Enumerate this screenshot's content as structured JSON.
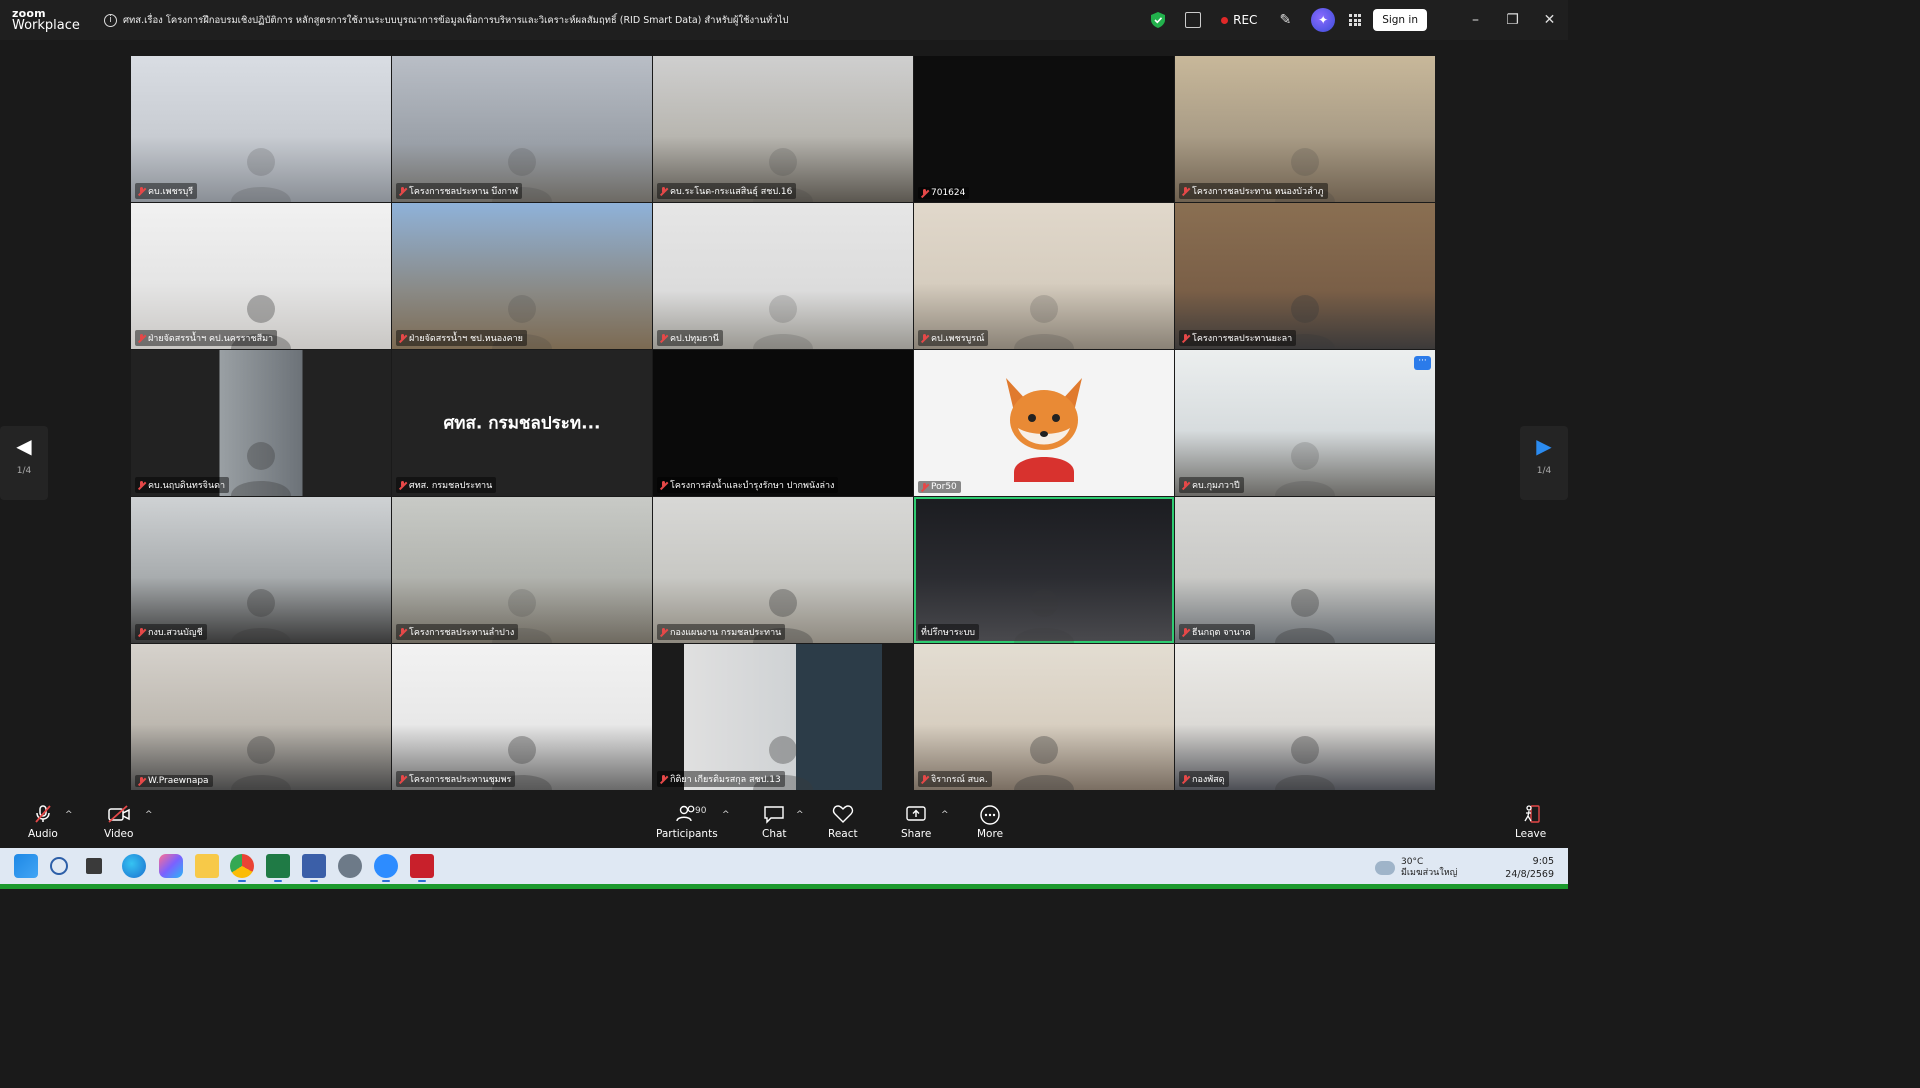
{
  "titlebar": {
    "logo_line1": "zoom",
    "logo_line2": "Workplace",
    "meeting_topic": "ศทส.เรื่อง โครงการฝึกอบรมเชิงปฏิบัติการ หลักสูตรการใช้งานระบบบูรณาการข้อมูลเพื่อการบริหารและวิเคราะห์ผลสัมฤทธิ์ (RID Smart Data) สำหรับผู้ใช้งานทั่วไป",
    "rec_label": "REC",
    "sign_in_label": "Sign in",
    "icons": [
      "info-icon",
      "shield-icon",
      "notes-icon",
      "brush-icon",
      "ai-companion-icon",
      "apps-grid-icon",
      "minimize-icon",
      "restore-icon",
      "close-icon"
    ],
    "colors": {
      "shield": "#22b14c",
      "rec_dot": "#e02828"
    }
  },
  "grid": {
    "tiles": [
      {
        "name": "คบ.เพชรบุรี",
        "muted": true,
        "video": true
      },
      {
        "name": "โครงการชลประทาน บึงกาฬ",
        "muted": true,
        "video": true
      },
      {
        "name": "คบ.ระโนด-กระแสสินธุ์ สชป.16",
        "muted": true,
        "video": true
      },
      {
        "name": "701624",
        "muted": true,
        "video": false
      },
      {
        "name": "โครงการชลประทาน หนองบัวลำภู",
        "muted": true,
        "video": true
      },
      {
        "name": "ฝ่ายจัดสรรน้ำฯ คป.นครราชสีมา",
        "muted": true,
        "video": true
      },
      {
        "name": "ฝ่ายจัดสรรน้ำฯ ชป.หนองคาย",
        "muted": true,
        "video": true
      },
      {
        "name": "คป.ปทุมธานี",
        "muted": true,
        "video": true
      },
      {
        "name": "คป.เพชรบูรณ์",
        "muted": true,
        "video": true
      },
      {
        "name": "โครงการชลประทานยะลา",
        "muted": true,
        "video": true
      },
      {
        "name": "คบ.นฤบดินทรจินดา",
        "muted": true,
        "video": true
      },
      {
        "name": "ศทส. กรมชลประทาน",
        "muted": true,
        "video": false,
        "display_name": "ศทส. กรมชลประท..."
      },
      {
        "name": "โครงการส่งน้ำและบำรุงรักษา ปากพนังล่าง",
        "muted": true,
        "video": false
      },
      {
        "name": "Por50",
        "muted": true,
        "video": true,
        "avatar": "fox"
      },
      {
        "name": "คบ.กุมภวาปี",
        "muted": true,
        "video": true
      },
      {
        "name": "กงบ.สวนบัญชี",
        "muted": true,
        "video": true
      },
      {
        "name": "โครงการชลประทานลำปาง",
        "muted": true,
        "video": true
      },
      {
        "name": "กองแผนงาน กรมชลประทาน",
        "muted": true,
        "video": true
      },
      {
        "name": "ที่ปรึกษาระบบ",
        "muted": false,
        "video": true,
        "active_speaker": true
      },
      {
        "name": "ธีนกฤต จานาค",
        "muted": true,
        "video": true
      },
      {
        "name": "W.Praewnapa",
        "muted": true,
        "video": true
      },
      {
        "name": "โครงการชลประทานชุมพร",
        "muted": true,
        "video": true
      },
      {
        "name": "กิติยา เกียรติมรสกุล สชป.13",
        "muted": true,
        "video": true
      },
      {
        "name": "จิรากรณ์ สบค.",
        "muted": true,
        "video": true
      },
      {
        "name": "กองพัสดุ",
        "muted": true,
        "video": true
      }
    ],
    "page_left": "1/4",
    "page_right": "1/4"
  },
  "toolbar": {
    "audio": "Audio",
    "video": "Video",
    "participants": "Participants",
    "participants_count": "90",
    "chat": "Chat",
    "react": "React",
    "share": "Share",
    "more": "More",
    "leave": "Leave"
  },
  "taskbar": {
    "apps": [
      "windows-start-icon",
      "search-icon",
      "task-view-icon",
      "edge-icon",
      "copilot-icon",
      "file-explorer-icon",
      "chrome-icon",
      "excel-icon",
      "network-app-icon",
      "settings-icon",
      "zoom-icon",
      "acrobat-icon"
    ],
    "weather_temp": "30°C",
    "weather_desc": "มีเมฆส่วนใหญ่",
    "time": "9:05",
    "date": "24/8/2569"
  }
}
